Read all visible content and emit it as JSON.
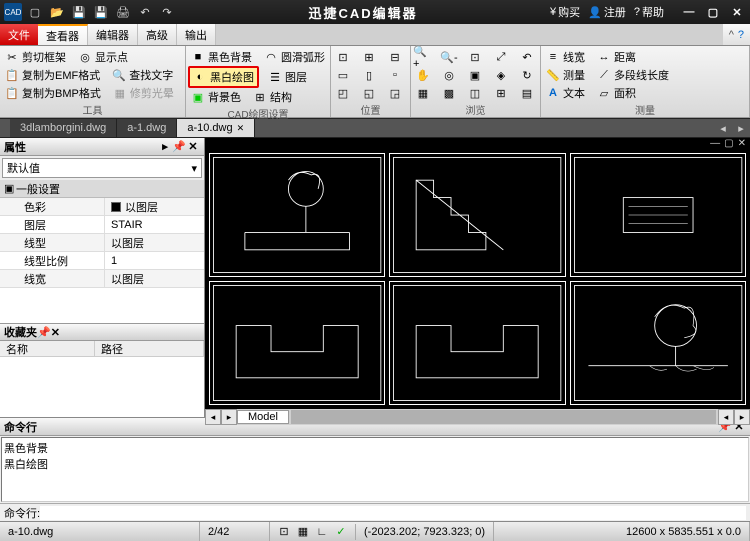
{
  "app_title": "迅捷CAD编辑器",
  "titlebar_right": {
    "buy": "购买",
    "register": "注册",
    "help": "帮助"
  },
  "menu": {
    "file": "文件",
    "viewer": "查看器",
    "editor": "编辑器",
    "advanced": "高级",
    "output": "输出"
  },
  "ribbon": {
    "g1": {
      "clip_frame": "剪切框架",
      "copy_emf": "复制为EMF格式",
      "copy_bmp": "复制为BMP格式",
      "show_point": "显示点",
      "find_text": "查找文字",
      "trim_halo": "修剪光晕",
      "label": "工具"
    },
    "g2": {
      "black_bg": "黑色背景",
      "bw_draw": "黑白绘图",
      "bg_color": "背景色",
      "smooth_arc": "圆滑弧形",
      "layer": "图层",
      "structure": "结构",
      "label": "CAD绘图设置"
    },
    "g3": {
      "label": "位置"
    },
    "g4": {
      "label": "浏览"
    },
    "g5": {
      "linewidth": "线宽",
      "measure": "测量",
      "text": "文本",
      "distance": "距离",
      "polyline_len": "多段线长度",
      "area": "面积",
      "label": "测量"
    }
  },
  "file_tabs": [
    "3dlamborgini.dwg",
    "a-1.dwg",
    "a-10.dwg"
  ],
  "props": {
    "header": "属性",
    "default_val": "默认值",
    "category": "一般设置",
    "rows": [
      {
        "k": "色彩",
        "v": "以图层",
        "swatch": true
      },
      {
        "k": "图层",
        "v": "STAIR"
      },
      {
        "k": "线型",
        "v": "以图层"
      },
      {
        "k": "线型比例",
        "v": "1"
      },
      {
        "k": "线宽",
        "v": "以图层"
      }
    ],
    "fav_header": "收藏夹",
    "fav_cols": {
      "name": "名称",
      "path": "路径"
    }
  },
  "model_tab": "Model",
  "cmd": {
    "header": "命令行",
    "history": [
      "黑色背景",
      "黑白绘图"
    ],
    "prompt": "命令行:"
  },
  "status": {
    "file": "a-10.dwg",
    "page": "2/42",
    "coords": "(-2023.202; 7923.323; 0)",
    "dims": "12600 x 5835.551 x 0.0"
  }
}
